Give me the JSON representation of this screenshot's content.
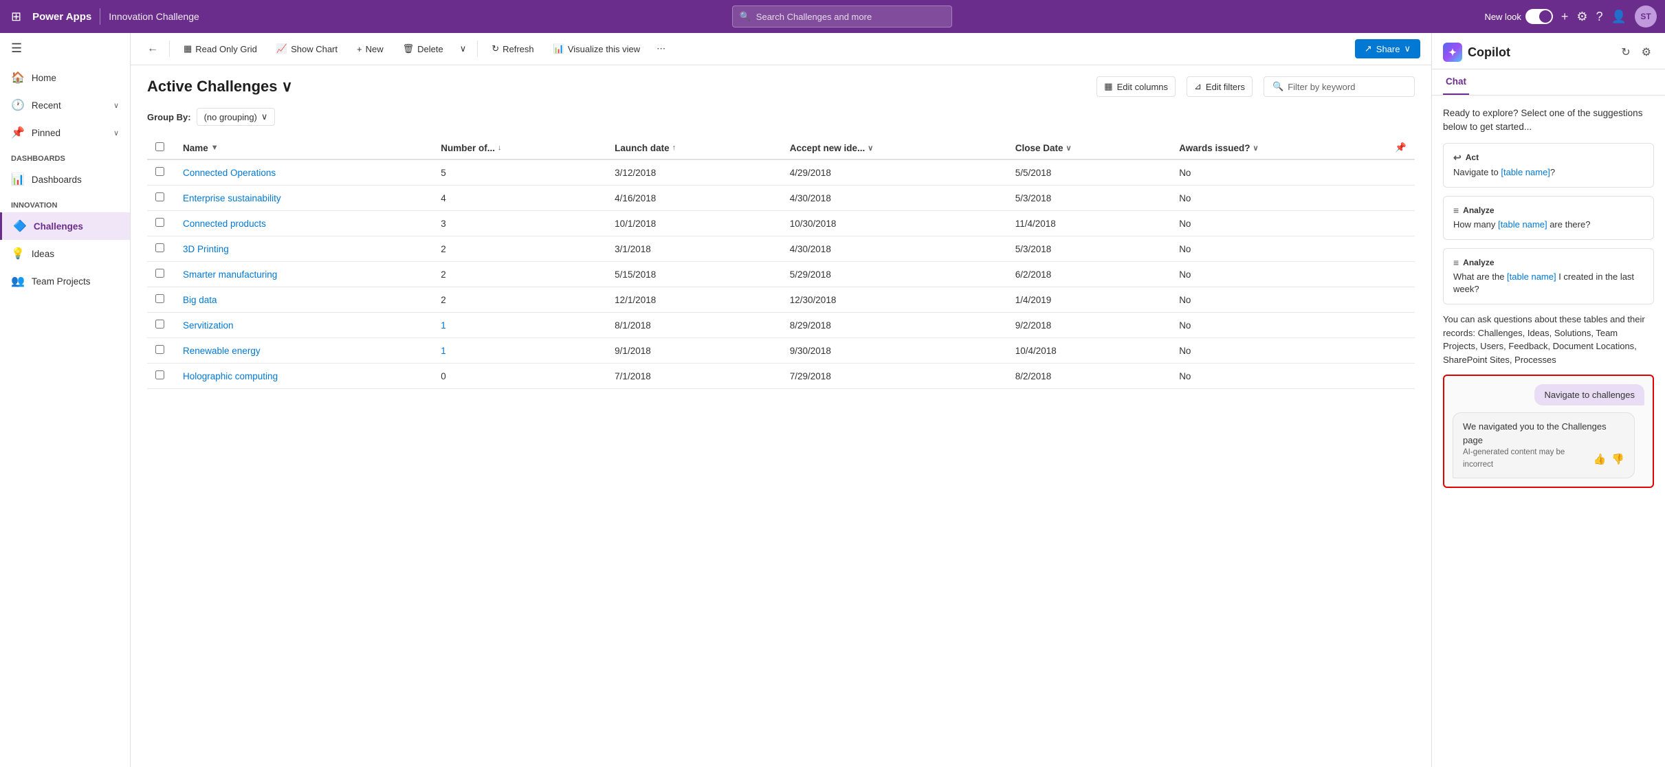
{
  "topbar": {
    "waffle_icon": "⊞",
    "brand": "Power Apps",
    "divider": "|",
    "app_name": "Innovation Challenge",
    "search_placeholder": "Search Challenges and more",
    "new_look_label": "New look",
    "plus_icon": "+",
    "settings_icon": "⚙",
    "help_icon": "?",
    "people_icon": "👤",
    "avatar_label": "ST"
  },
  "sidebar": {
    "collapse_icon": "☰",
    "items": [
      {
        "label": "Home",
        "icon": "🏠",
        "has_chevron": false
      },
      {
        "label": "Recent",
        "icon": "🕐",
        "has_chevron": true
      },
      {
        "label": "Pinned",
        "icon": "📌",
        "has_chevron": true
      }
    ],
    "sections": [
      {
        "title": "Dashboards",
        "items": [
          {
            "label": "Dashboards",
            "icon": "📊",
            "active": false
          }
        ]
      },
      {
        "title": "Innovation",
        "items": [
          {
            "label": "Challenges",
            "icon": "🔷",
            "active": true
          },
          {
            "label": "Ideas",
            "icon": "💡",
            "active": false
          },
          {
            "label": "Team Projects",
            "icon": "👥",
            "active": false
          }
        ]
      }
    ]
  },
  "toolbar": {
    "back_icon": "←",
    "read_only_grid_label": "Read Only Grid",
    "read_only_grid_icon": "▦",
    "show_chart_label": "Show Chart",
    "show_chart_icon": "📈",
    "new_label": "New",
    "new_icon": "+",
    "delete_label": "Delete",
    "delete_icon": "🗑",
    "dropdown_icon": "∨",
    "refresh_label": "Refresh",
    "refresh_icon": "↻",
    "visualize_label": "Visualize this view",
    "visualize_icon": "📊",
    "more_icon": "⋯",
    "share_label": "Share",
    "share_icon": "↗"
  },
  "view": {
    "title": "Active Challenges",
    "title_chevron": "∨",
    "edit_columns_label": "Edit columns",
    "edit_columns_icon": "▦",
    "edit_filters_label": "Edit filters",
    "edit_filters_icon": "⊿",
    "filter_placeholder": "Filter by keyword",
    "filter_icon": "🔍",
    "group_by_label": "Group By:",
    "group_by_value": "(no grouping)",
    "group_by_chevron": "∨"
  },
  "grid": {
    "columns": [
      {
        "label": "Name",
        "sort": "▼",
        "has_sort": true
      },
      {
        "label": "Number of...",
        "sort": "↓",
        "has_sort": true
      },
      {
        "label": "Launch date",
        "sort": "↑",
        "has_sort": true
      },
      {
        "label": "Accept new ide...",
        "sort": "∨",
        "has_sort": true
      },
      {
        "label": "Close Date",
        "sort": "∨",
        "has_sort": true
      },
      {
        "label": "Awards issued?",
        "sort": "∨",
        "has_sort": true
      }
    ],
    "rows": [
      {
        "name": "Connected Operations",
        "count": "5",
        "count_link": false,
        "launch": "3/12/2018",
        "accept": "4/29/2018",
        "close": "5/5/2018",
        "awards": "No"
      },
      {
        "name": "Enterprise sustainability",
        "count": "4",
        "count_link": false,
        "launch": "4/16/2018",
        "accept": "4/30/2018",
        "close": "5/3/2018",
        "awards": "No"
      },
      {
        "name": "Connected products",
        "count": "3",
        "count_link": false,
        "launch": "10/1/2018",
        "accept": "10/30/2018",
        "close": "11/4/2018",
        "awards": "No"
      },
      {
        "name": "3D Printing",
        "count": "2",
        "count_link": false,
        "launch": "3/1/2018",
        "accept": "4/30/2018",
        "close": "5/3/2018",
        "awards": "No"
      },
      {
        "name": "Smarter manufacturing",
        "count": "2",
        "count_link": false,
        "launch": "5/15/2018",
        "accept": "5/29/2018",
        "close": "6/2/2018",
        "awards": "No"
      },
      {
        "name": "Big data",
        "count": "2",
        "count_link": false,
        "launch": "12/1/2018",
        "accept": "12/30/2018",
        "close": "1/4/2019",
        "awards": "No"
      },
      {
        "name": "Servitization",
        "count": "1",
        "count_link": true,
        "launch": "8/1/2018",
        "accept": "8/29/2018",
        "close": "9/2/2018",
        "awards": "No"
      },
      {
        "name": "Renewable energy",
        "count": "1",
        "count_link": true,
        "launch": "9/1/2018",
        "accept": "9/30/2018",
        "close": "10/4/2018",
        "awards": "No"
      },
      {
        "name": "Holographic computing",
        "count": "0",
        "count_link": false,
        "launch": "7/1/2018",
        "accept": "7/29/2018",
        "close": "8/2/2018",
        "awards": "No"
      }
    ]
  },
  "copilot": {
    "title": "Copilot",
    "logo_icon": "✦",
    "refresh_icon": "↻",
    "settings_icon": "⚙",
    "tabs": [
      {
        "label": "Chat",
        "active": true
      }
    ],
    "intro_text": "Ready to explore? Select one of the suggestions below to get started...",
    "suggestions": [
      {
        "type": "Act",
        "type_icon": "↩",
        "text_before": "Navigate to ",
        "link_text": "[table name]",
        "text_after": "?"
      },
      {
        "type": "Analyze",
        "type_icon": "≡",
        "text_before": "How many ",
        "link_text": "[table name]",
        "text_after": " are there?"
      },
      {
        "type": "Analyze",
        "type_icon": "≡",
        "text_before": "What are the ",
        "link_text": "[table name]",
        "text_after": " I created in the last week?"
      }
    ],
    "footer_text": "You can ask questions about these tables and their records: Challenges, Ideas, Solutions, Team Projects, Users, Feedback, Document Locations, SharePoint Sites, Processes",
    "user_message": "Navigate to challenges",
    "bot_response": "We navigated you to the Challenges page",
    "bot_disclaimer": "AI-generated content may be incorrect",
    "thumbs_up_icon": "👍",
    "thumbs_down_icon": "👎"
  }
}
